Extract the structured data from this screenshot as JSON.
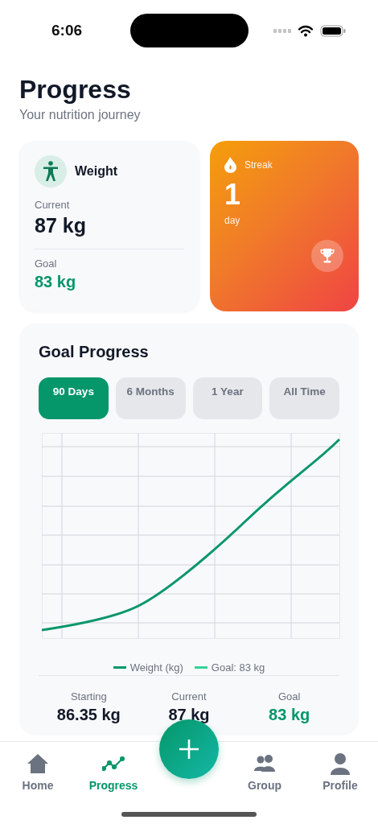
{
  "status_bar": {
    "time": "6:06"
  },
  "header": {
    "title": "Progress",
    "subtitle": "Your nutrition journey"
  },
  "weight_card": {
    "title": "Weight",
    "current_label": "Current",
    "current_value": "87 kg",
    "goal_label": "Goal",
    "goal_value": "83 kg"
  },
  "streak_card": {
    "label": "Streak",
    "value": "1",
    "unit": "day"
  },
  "goal_progress": {
    "title": "Goal Progress",
    "ranges": [
      {
        "label": "90 Days",
        "selected": true
      },
      {
        "label": "6 Months",
        "selected": false
      },
      {
        "label": "1 Year",
        "selected": false
      },
      {
        "label": "All Time",
        "selected": false
      }
    ],
    "legend": [
      {
        "label": "Weight (kg)",
        "color": "#059669"
      },
      {
        "label": "Goal: 83 kg",
        "color": "#34d399"
      }
    ],
    "stats": [
      {
        "label": "Starting",
        "value": "86.35 kg",
        "kind": "plain"
      },
      {
        "label": "Current",
        "value": "87 kg",
        "kind": "plain"
      },
      {
        "label": "Goal",
        "value": "83 kg",
        "kind": "goal"
      }
    ]
  },
  "tab_bar": {
    "items": [
      {
        "label": "Home",
        "kind": "home",
        "selected": false
      },
      {
        "label": "Progress",
        "kind": "progress",
        "selected": true
      },
      {
        "label": "Group",
        "kind": "group",
        "selected": false
      },
      {
        "label": "Profile",
        "kind": "profile",
        "selected": false
      }
    ]
  }
}
